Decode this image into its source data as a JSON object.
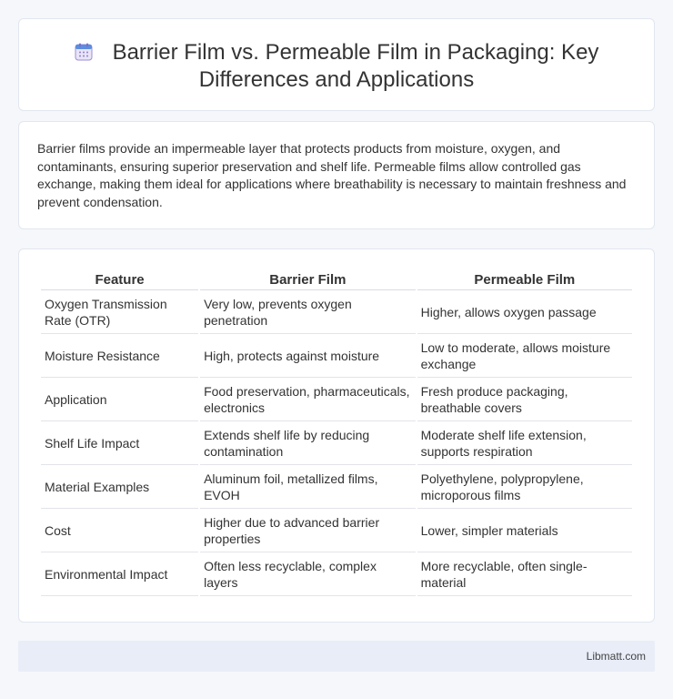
{
  "header": {
    "icon": "calendar-icon",
    "title": "Barrier Film vs. Permeable Film in Packaging: Key Differences and Applications"
  },
  "intro": "Barrier films provide an impermeable layer that protects products from moisture, oxygen, and contaminants, ensuring superior preservation and shelf life. Permeable films allow controlled gas exchange, making them ideal for applications where breathability is necessary to maintain freshness and prevent condensation.",
  "table": {
    "headers": [
      "Feature",
      "Barrier Film",
      "Permeable Film"
    ],
    "rows": [
      [
        "Oxygen Transmission Rate (OTR)",
        "Very low, prevents oxygen penetration",
        "Higher, allows oxygen passage"
      ],
      [
        "Moisture Resistance",
        "High, protects against moisture",
        "Low to moderate, allows moisture exchange"
      ],
      [
        "Application",
        "Food preservation, pharmaceuticals, electronics",
        "Fresh produce packaging, breathable covers"
      ],
      [
        "Shelf Life Impact",
        "Extends shelf life by reducing contamination",
        "Moderate shelf life extension, supports respiration"
      ],
      [
        "Material Examples",
        "Aluminum foil, metallized films, EVOH",
        "Polyethylene, polypropylene, microporous films"
      ],
      [
        "Cost",
        "Higher due to advanced barrier properties",
        "Lower, simpler materials"
      ],
      [
        "Environmental Impact",
        "Often less recyclable, complex layers",
        "More recyclable, often single-material"
      ]
    ]
  },
  "footer": {
    "brand": "Libmatt.com"
  }
}
